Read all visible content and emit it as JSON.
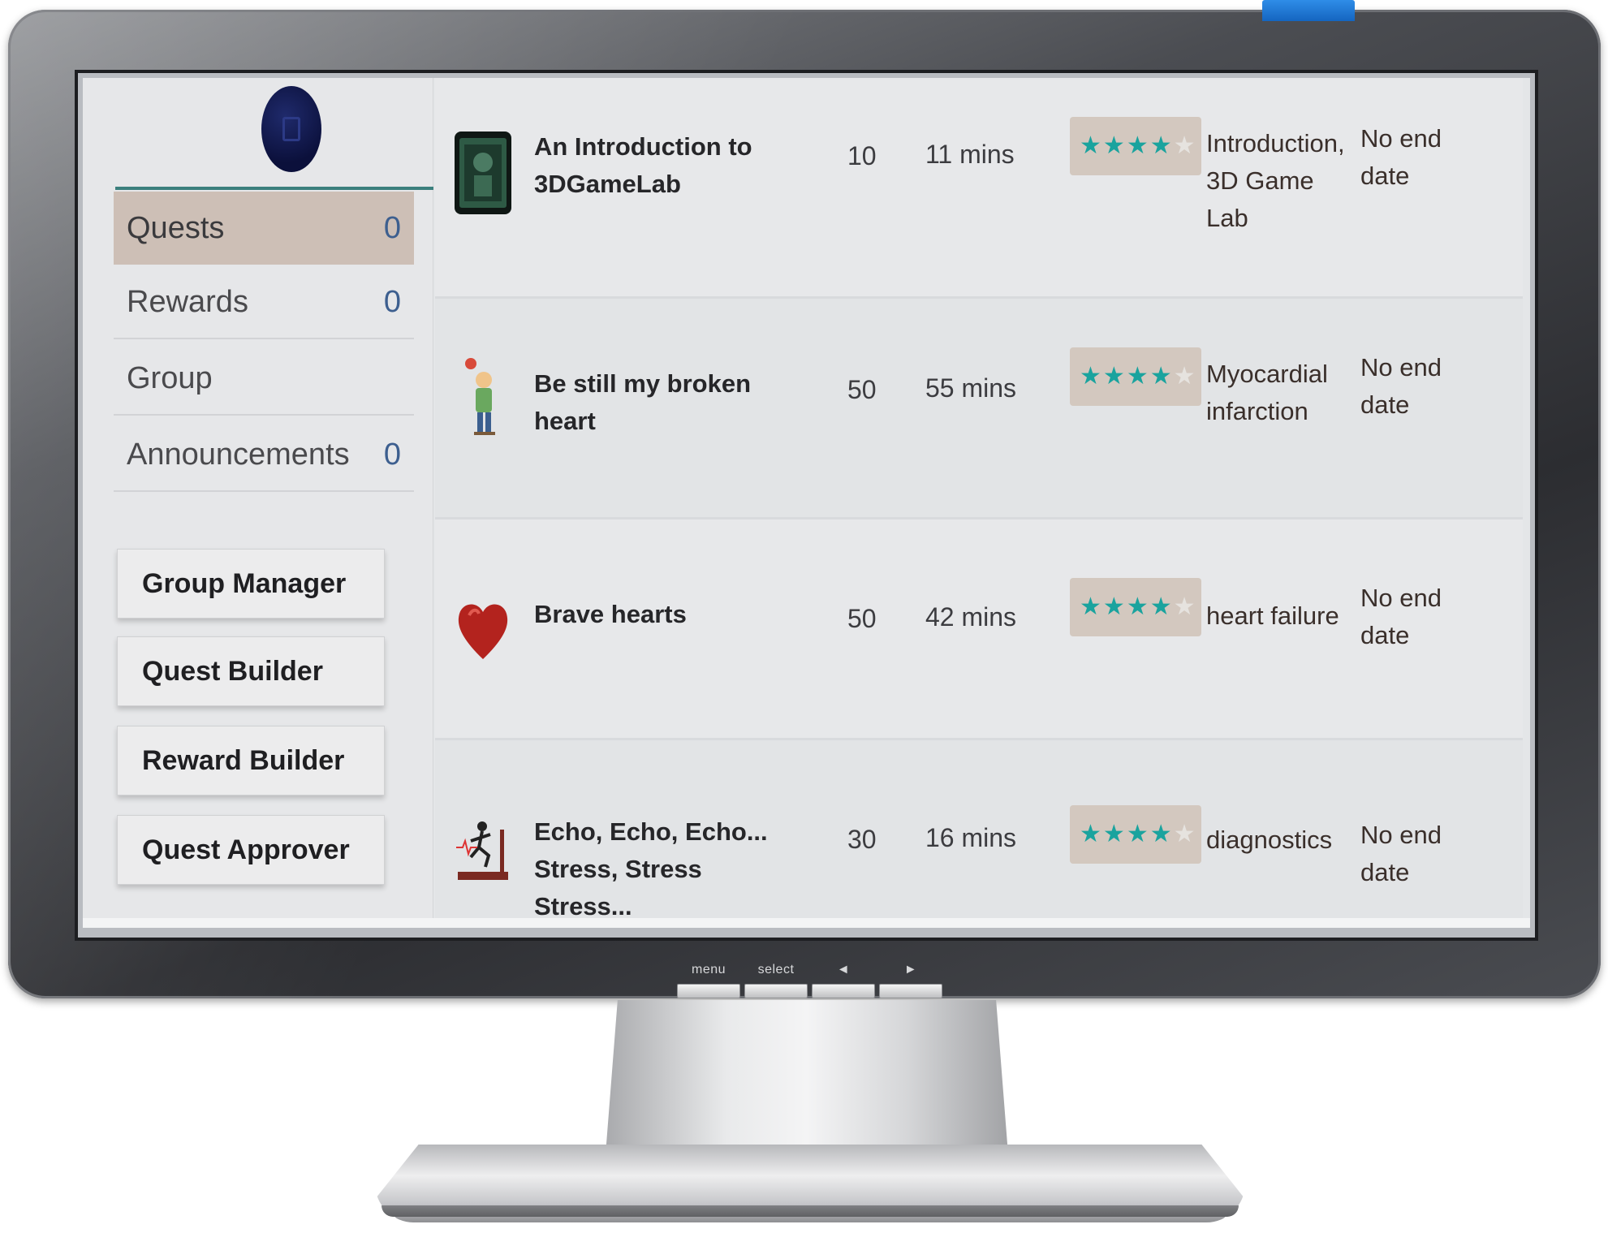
{
  "monitor": {
    "controls": [
      "menu",
      "select",
      "◄",
      "►"
    ]
  },
  "sidebar": {
    "items": [
      {
        "label": "Quests",
        "count": "0"
      },
      {
        "label": "Rewards",
        "count": "0"
      },
      {
        "label": "Group",
        "count": ""
      },
      {
        "label": "Announcements",
        "count": "0"
      }
    ],
    "tools": [
      "Group Manager",
      "Quest Builder",
      "Reward Builder",
      "Quest Approver"
    ]
  },
  "quests": [
    {
      "name": "An Introduction to 3DGameLab",
      "points": "10",
      "duration": "11 mins",
      "rating": 3.5,
      "tags": "Introduction, 3D Game Lab",
      "end": "No end date",
      "icon": "game-thumbnail-icon"
    },
    {
      "name": "Be still my broken heart",
      "points": "50",
      "duration": "55 mins",
      "rating": 3.5,
      "tags": "Myocardial infarction",
      "end": "No end date",
      "icon": "broken-heart-figure-icon"
    },
    {
      "name": "Brave hearts",
      "points": "50",
      "duration": "42 mins",
      "rating": 3.5,
      "tags": "heart failure",
      "end": "No end date",
      "icon": "red-heart-icon"
    },
    {
      "name": "Echo, Echo, Echo... Stress, Stress Stress...",
      "points": "30",
      "duration": "16 mins",
      "rating": 3.5,
      "tags": "diagnostics",
      "end": "No end date",
      "icon": "treadmill-runner-icon"
    }
  ],
  "colors": {
    "active_nav": "#cdbfb6",
    "accent_rule": "#3b7f7d",
    "star": "#1aa39e",
    "count": "#3d5f8f"
  }
}
